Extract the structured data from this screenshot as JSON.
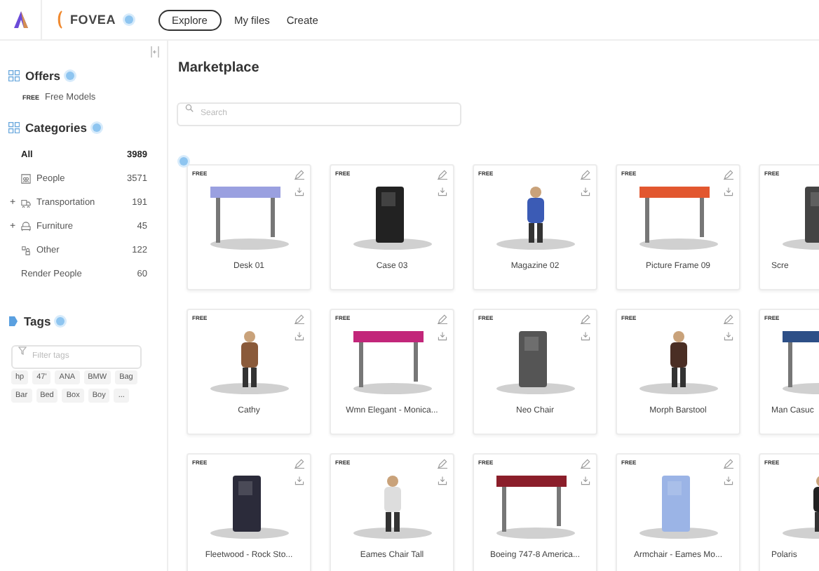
{
  "topbar": {
    "brand": "FOVEA",
    "nav": [
      {
        "label": "Explore",
        "selected": true
      },
      {
        "label": "My files",
        "selected": false
      },
      {
        "label": "Create",
        "selected": false
      }
    ]
  },
  "sidebar": {
    "offers": {
      "title": "Offers",
      "items": [
        {
          "badge": "FREE",
          "label": "Free Models"
        }
      ]
    },
    "categories": {
      "title": "Categories",
      "items": [
        {
          "label": "All",
          "count": "3989",
          "selected": true
        },
        {
          "label": "People",
          "count": "3571",
          "selected": false
        },
        {
          "toggle": "+",
          "label": "Transportation",
          "count": "191",
          "selected": false
        },
        {
          "toggle": "+",
          "label": "Furniture",
          "count": "45",
          "selected": false
        },
        {
          "label": "Other",
          "count": "122",
          "selected": false
        },
        {
          "label": "Render People",
          "count": "60",
          "selected": false
        }
      ]
    },
    "tags": {
      "title": "Tags",
      "placeholder": "Filter tags",
      "items": [
        "hp",
        "47'",
        "ANA",
        "BMW",
        "Bag",
        "Bar",
        "Bed",
        "Box",
        "Boy",
        "..."
      ]
    }
  },
  "main": {
    "title": "Marketplace",
    "search_placeholder": "Search",
    "cards": [
      {
        "badge": "FREE",
        "title": "Desk 01"
      },
      {
        "badge": "FREE",
        "title": "Case 03"
      },
      {
        "badge": "FREE",
        "title": "Magazine 02"
      },
      {
        "badge": "FREE",
        "title": "Picture Frame 09"
      },
      {
        "badge": "FREE",
        "title": "Scre"
      },
      {
        "badge": "FREE",
        "title": "Cathy"
      },
      {
        "badge": "FREE",
        "title": "Wmn Elegant - Monica..."
      },
      {
        "badge": "FREE",
        "title": "Neo Chair"
      },
      {
        "badge": "FREE",
        "title": "Morph Barstool"
      },
      {
        "badge": "FREE",
        "title": "Man Casuc"
      },
      {
        "badge": "FREE",
        "title": "Fleetwood - Rock Sto..."
      },
      {
        "badge": "FREE",
        "title": "Eames Chair Tall"
      },
      {
        "badge": "FREE",
        "title": "Boeing 747-8 America..."
      },
      {
        "badge": "FREE",
        "title": "Armchair - Eames Mo..."
      },
      {
        "badge": "FREE",
        "title": "Polaris"
      }
    ]
  }
}
